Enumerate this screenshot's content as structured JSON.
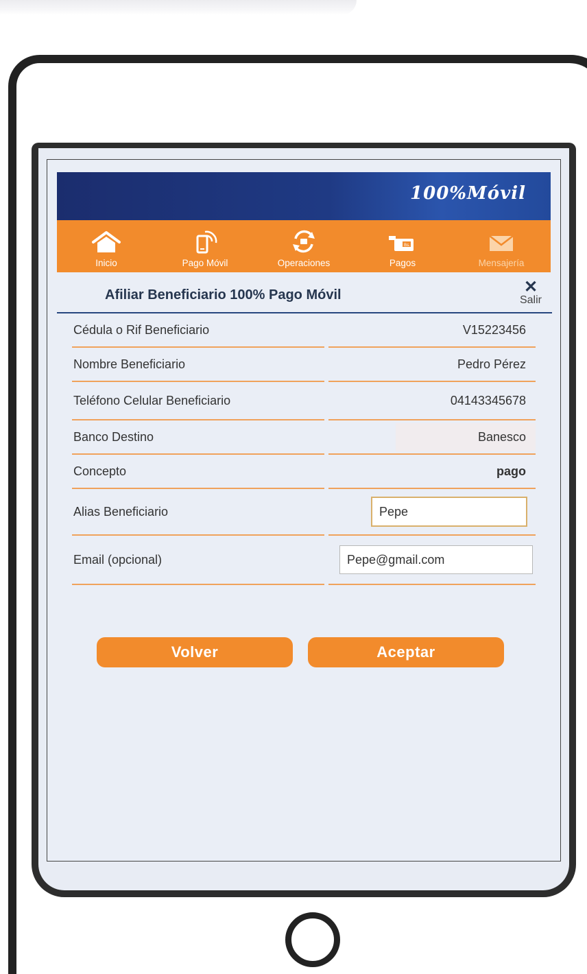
{
  "app": {
    "logo_text": "100%Móvil"
  },
  "nav": {
    "items": [
      {
        "label": "Inicio",
        "icon": "home-icon"
      },
      {
        "label": "Pago Móvil",
        "icon": "mobile-payment-icon"
      },
      {
        "label": "Operaciones",
        "icon": "operations-icon"
      },
      {
        "label": "Pagos",
        "icon": "payments-icon"
      },
      {
        "label": "Mensajería",
        "icon": "mail-icon"
      }
    ]
  },
  "page": {
    "title": "Afiliar Beneficiario 100% Pago Móvil",
    "exit_label": "Salir"
  },
  "form": {
    "rows": [
      {
        "label": "Cédula o Rif Beneficiario",
        "value": "V15223456"
      },
      {
        "label": "Nombre Beneficiario",
        "value": "Pedro Pérez"
      },
      {
        "label": "Teléfono Celular Beneficiario",
        "value": "04143345678"
      },
      {
        "label": "Banco Destino",
        "value": "Banesco"
      },
      {
        "label": "Concepto",
        "value": "pago"
      }
    ],
    "alias": {
      "label": "Alias Beneficiario",
      "value": "Pepe"
    },
    "email": {
      "label": "Email (opcional)",
      "value": "Pepe@gmail.com"
    }
  },
  "buttons": {
    "back": "Volver",
    "accept": "Aceptar"
  },
  "colors": {
    "orange": "#f28b2c",
    "navy": "#1b2d6e",
    "divider": "#f0a25b",
    "title": "#26364f"
  }
}
